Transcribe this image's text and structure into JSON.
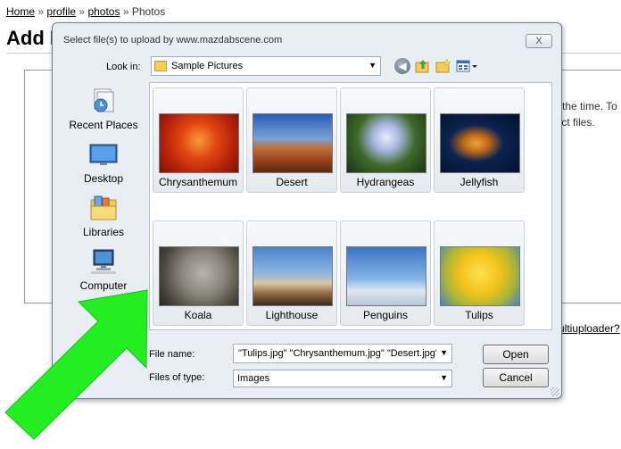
{
  "page": {
    "breadcrumb": {
      "home": "Home",
      "profile": "profile",
      "photos_link": "photos",
      "current": "Photos",
      "separator": "»"
    },
    "title": "Add P",
    "bg_text_line1": "e the time. To",
    "bg_text_line2": "lect files.",
    "bg_link": "ultiuploader?"
  },
  "dialog": {
    "title": "Select file(s) to upload by www.mazdabscene.com",
    "close_label": "X",
    "look_in_label": "Look in:",
    "look_in_value": "Sample Pictures",
    "places": [
      {
        "label": "Recent Places"
      },
      {
        "label": "Desktop"
      },
      {
        "label": "Libraries"
      },
      {
        "label": "Computer"
      }
    ],
    "files": [
      {
        "name": "Chrysanthemum"
      },
      {
        "name": "Desert"
      },
      {
        "name": "Hydrangeas"
      },
      {
        "name": "Jellyfish"
      },
      {
        "name": "Koala"
      },
      {
        "name": "Lighthouse"
      },
      {
        "name": "Penguins"
      },
      {
        "name": "Tulips"
      }
    ],
    "file_name_label": "File name:",
    "file_name_value": "\"Tulips.jpg\" \"Chrysanthemum.jpg\" \"Desert.jpg\"",
    "file_type_label": "Files of type:",
    "file_type_value": "Images",
    "open_label": "Open",
    "cancel_label": "Cancel"
  },
  "colors": {
    "annotation_arrow": "#22ee22",
    "dialog_bg": "#e9eef5"
  }
}
